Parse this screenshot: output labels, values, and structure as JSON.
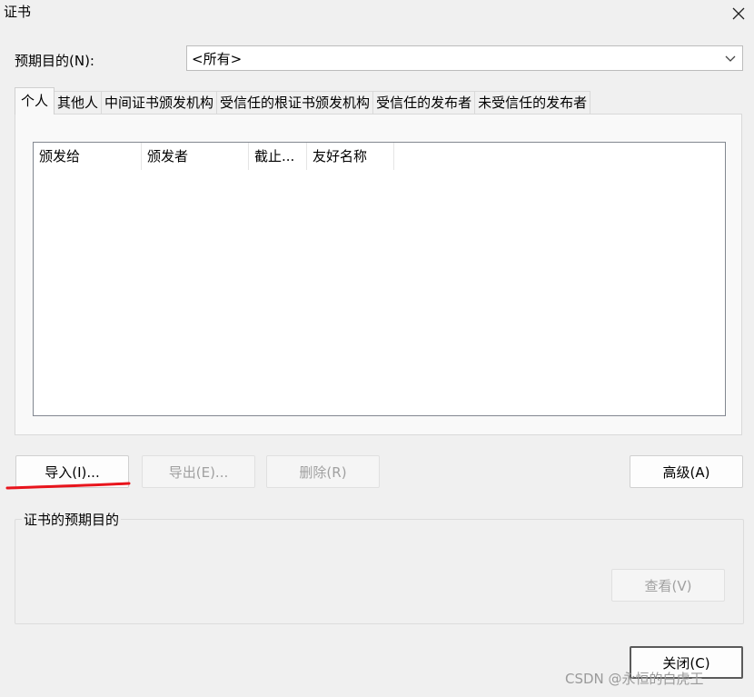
{
  "window": {
    "title": "证书"
  },
  "purpose": {
    "label": "预期目的(N):",
    "selected": "<所有>"
  },
  "tabs": [
    {
      "label": "个人"
    },
    {
      "label": "其他人"
    },
    {
      "label": "中间证书颁发机构"
    },
    {
      "label": "受信任的根证书颁发机构"
    },
    {
      "label": "受信任的发布者"
    },
    {
      "label": "未受信任的发布者"
    }
  ],
  "list": {
    "columns": [
      "颁发给",
      "颁发者",
      "截止...",
      "友好名称"
    ],
    "rows": []
  },
  "buttons": {
    "import": "导入(I)...",
    "export": "导出(E)...",
    "remove": "删除(R)",
    "advanced": "高级(A)",
    "view": "查看(V)",
    "close": "关闭(C)"
  },
  "group": {
    "legend": "证书的预期目的"
  },
  "watermark": "CSDN @永恒的白虎王",
  "colors": {
    "annotation": "#e8141c"
  }
}
